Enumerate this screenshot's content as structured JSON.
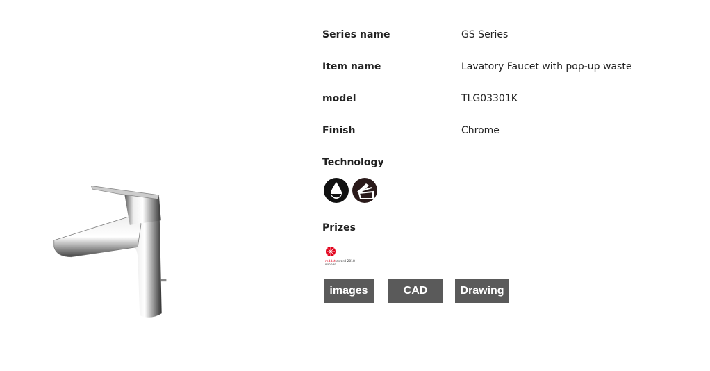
{
  "product": {
    "fields": [
      {
        "label": "Series name",
        "value": "GS Series"
      },
      {
        "label": "Item name",
        "value": "Lavatory Faucet with pop-up waste"
      },
      {
        "label": "model",
        "value": "TLG03301K"
      },
      {
        "label": "Finish",
        "value": "Chrome"
      }
    ],
    "technology_label": "Technology",
    "technology_icons": [
      "water-drop-icon",
      "pop-up-waste-icon"
    ],
    "prizes_label": "Prizes",
    "prize": {
      "logo_text": "reddot award 2018",
      "sub_text": "winner",
      "color": "#e2001a"
    }
  },
  "buttons": {
    "images": "images",
    "cad": "CAD",
    "drawing": "Drawing"
  },
  "colors": {
    "button_bg": "#5a5a5a"
  }
}
